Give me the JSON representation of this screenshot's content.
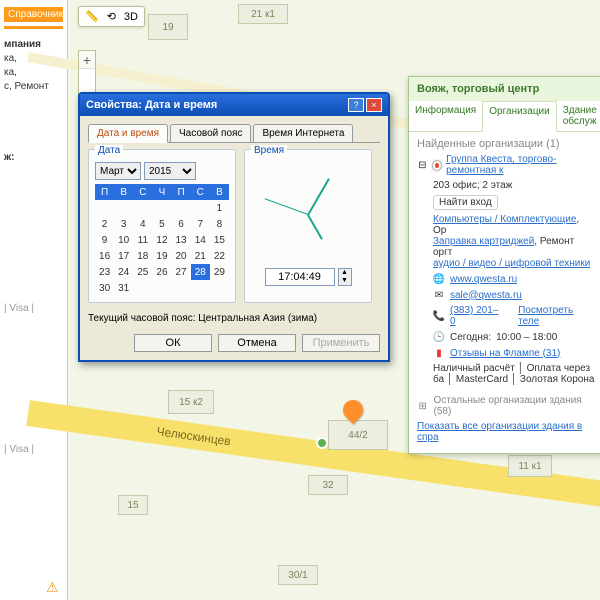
{
  "sidebar": {
    "header": "Справочники",
    "group1": "мпания",
    "items1": [
      "ка,",
      "ка,",
      "с, Ремонт"
    ],
    "group2": "ж:",
    "foot": [
      "| Visa |",
      "| Visa |"
    ]
  },
  "toolbar": {
    "ruler": "📏",
    "compass": "⟲",
    "threeD": "3D"
  },
  "road_name": "Челюскинцев",
  "buildings": {
    "b1": "19",
    "b2": "21 к1",
    "b3": "15 к2",
    "b4": "44/2",
    "b5": "32",
    "b6": "30/1",
    "b7": "11 к1",
    "b8": "15"
  },
  "zoom": {
    "plus": "+",
    "minus": "−"
  },
  "dialog": {
    "title": "Свойства: Дата и время",
    "help": "?",
    "close": "×",
    "tabs": [
      "Дата и время",
      "Часовой пояс",
      "Время Интернета"
    ],
    "date_label": "Дата",
    "time_label": "Время",
    "month": "Март",
    "year": "2015",
    "dow": [
      "П",
      "В",
      "С",
      "Ч",
      "П",
      "С",
      "В"
    ],
    "weeks": [
      [
        "",
        "",
        "",
        "",
        "",
        "",
        "1"
      ],
      [
        "2",
        "3",
        "4",
        "5",
        "6",
        "7",
        "8"
      ],
      [
        "9",
        "10",
        "11",
        "12",
        "13",
        "14",
        "15"
      ],
      [
        "16",
        "17",
        "18",
        "19",
        "20",
        "21",
        "22"
      ],
      [
        "23",
        "24",
        "25",
        "26",
        "27",
        "28",
        "29"
      ],
      [
        "30",
        "31",
        "",
        "",
        "",
        "",
        ""
      ]
    ],
    "selected_day": "28",
    "time_value": "17:04:49",
    "tz_text": "Текущий часовой пояс: Центральная Азия (зима)",
    "ok": "ОК",
    "cancel": "Отмена",
    "apply": "Применить"
  },
  "panel": {
    "title": "Вояж, торговый центр",
    "tabs": [
      "Информация",
      "Организации",
      "Здание обслуж"
    ],
    "found": "Найденные организации (1)",
    "org_name": "Группа Квеста, торгово-ремонтная к",
    "addr": "203 офис; 2 этаж",
    "find_entry": "Найти вход",
    "cat1": "Компьютеры / Комплектующие",
    "cat1b": ", Ор",
    "cat2": "Заправка картриджей",
    "cat2b": ", Ремонт оргт",
    "cat3": "аудио / видео / цифровой техники",
    "site": "www.qwesta.ru",
    "email": "sale@qwesta.ru",
    "phone": "(383) 201–0",
    "phone_more": "Посмотреть теле",
    "hours_lbl": "Сегодня: ",
    "hours": "10:00 – 18:00",
    "reviews": "Отзывы на Флампе (31)",
    "pay": "Наличный расчёт │ Оплата через ба │ MasterCard │ Золотая Корона",
    "rest": "Остальные организации здания (58)",
    "show_all": "Показать все организации здания в спра"
  }
}
